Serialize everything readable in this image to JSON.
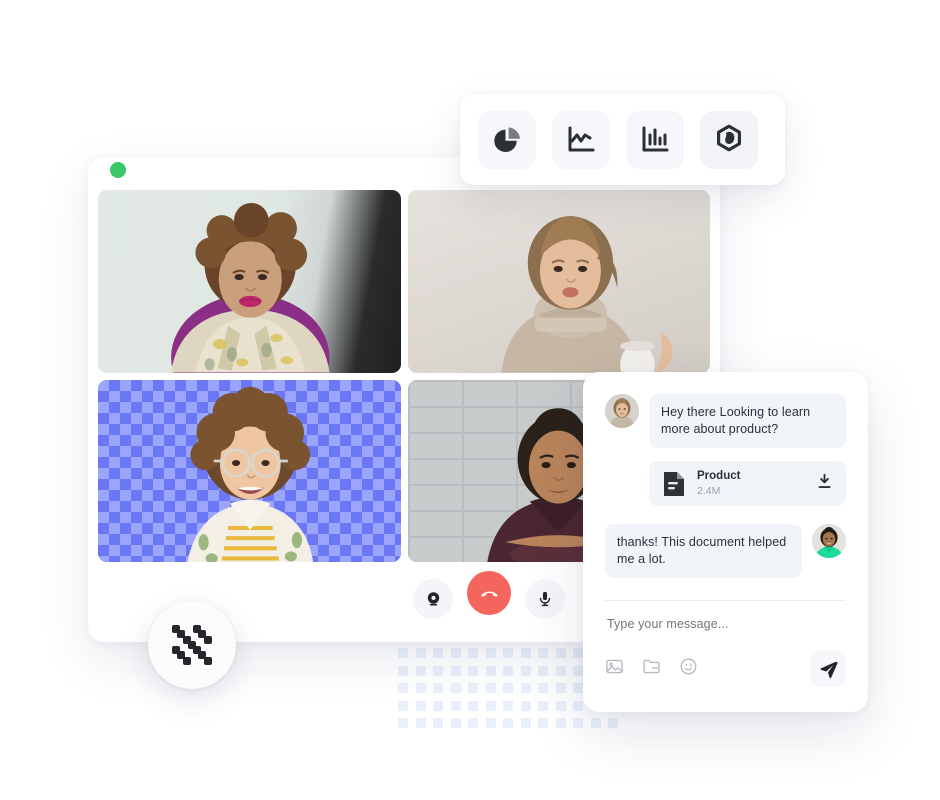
{
  "window": {
    "status_dot_color": "#3cc86a",
    "status_label": "online-indicator"
  },
  "chart_toolbar": {
    "buttons": [
      {
        "icon": "pie-chart-icon",
        "label": "Pie chart",
        "active": false
      },
      {
        "icon": "line-chart-icon",
        "label": "Line chart",
        "active": false
      },
      {
        "icon": "bar-chart-icon",
        "label": "Bar chart",
        "active": false
      },
      {
        "icon": "hexagon-blob-icon",
        "label": "Shape tool",
        "active": true
      }
    ]
  },
  "video_grid": {
    "tiles": [
      {
        "name": "participant-1",
        "background": "office-window",
        "selected": false
      },
      {
        "name": "participant-2",
        "background": "studio-wall",
        "selected": false
      },
      {
        "name": "participant-3",
        "background": "transparent-checkerboard",
        "selected": true
      },
      {
        "name": "participant-4",
        "background": "brick-wall",
        "selected": false
      }
    ],
    "checker_color_dark": "#6c77f5",
    "checker_color_light": "#9aa5fb",
    "selected_outline_color": "#5b67f3"
  },
  "call_controls": {
    "camera": {
      "icon": "webcam-icon",
      "label": "Camera"
    },
    "hangup": {
      "icon": "phone-hangup-icon",
      "label": "End call",
      "color": "#f4655e"
    },
    "microphone": {
      "icon": "microphone-icon",
      "label": "Microphone"
    },
    "grid_fab": {
      "icon": "checker-dots-icon",
      "label": "Background grid"
    }
  },
  "chat": {
    "messages": [
      {
        "direction": "in",
        "avatar": "woman-avatar",
        "text": "Hey there Looking to learn more about product?"
      },
      {
        "direction": "out",
        "avatar": "man-avatar",
        "text": "thanks!  This document helped me a lot."
      }
    ],
    "attachment": {
      "icon": "document-icon",
      "name": "Product",
      "size": "2.4M",
      "download_icon": "download-icon"
    },
    "composer": {
      "placeholder": "Type your message...",
      "value": "",
      "tools": [
        {
          "icon": "image-icon",
          "label": "Attach image"
        },
        {
          "icon": "folder-icon",
          "label": "Attach file"
        },
        {
          "icon": "emoji-icon",
          "label": "Emoji"
        }
      ],
      "send": {
        "icon": "send-icon",
        "label": "Send"
      }
    }
  },
  "decoration": {
    "dot_grid_color": "#eaf0fb",
    "dot_grid_cols": 13,
    "dot_grid_rows": 5
  }
}
